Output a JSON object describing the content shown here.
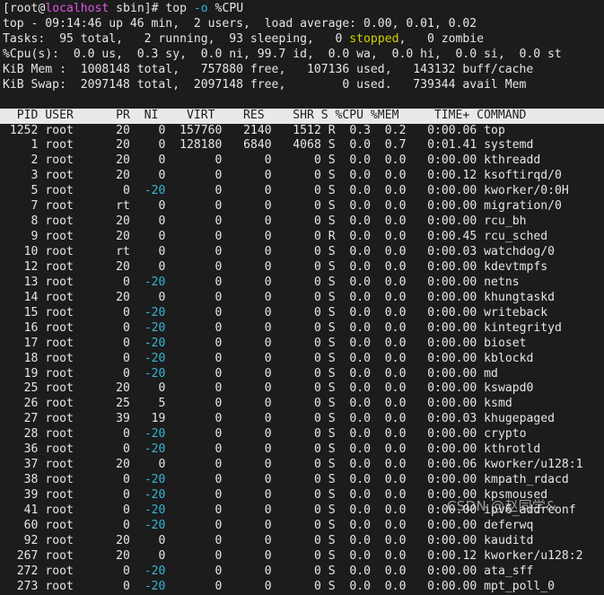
{
  "terminal": {
    "background": "#1c1c1c",
    "foreground": "#e6e6e6",
    "accent_magenta": "#e157e1",
    "accent_cyan": "#36b5d4",
    "accent_yellow": "#d2d200",
    "header_bar_bg": "#e9e9e9",
    "header_bar_fg": "#1c1c1c"
  },
  "prompt": {
    "bracket_open": "[",
    "user": "root",
    "at": "@",
    "host": "localhost",
    "space": " ",
    "dir": "sbin",
    "bracket_close": "]# ",
    "command": "top ",
    "flag": "-o",
    "flag_value": " %CPU"
  },
  "summary": {
    "line1": "top - 09:14:46 up 46 min,  2 users,  load average: 0.00, 0.01, 0.02",
    "tasks_pre": "Tasks:  95 total,   2 running,  93 sleeping,   0 ",
    "tasks_stopped": "stopped",
    "tasks_post": ",   0 zombie",
    "cpu": "%Cpu(s):  0.0 us,  0.3 sy,  0.0 ni, 99.7 id,  0.0 wa,  0.0 hi,  0.0 si,  0.0 st",
    "mem": "KiB Mem :  1008148 total,   757880 free,   107136 used,   143132 buff/cache",
    "swap": "KiB Swap:  2097148 total,  2097148 free,        0 used.   739344 avail Mem"
  },
  "table": {
    "header": "  PID USER      PR  NI    VIRT    RES    SHR S %CPU %MEM     TIME+ COMMAND",
    "columns": [
      "PID",
      "USER",
      "PR",
      "NI",
      "VIRT",
      "RES",
      "SHR",
      "S",
      "%CPU",
      "%MEM",
      "TIME+",
      "COMMAND"
    ],
    "rows": [
      {
        "pid": "1252",
        "user": "root",
        "pr": "20",
        "ni": "0",
        "ni_neg": false,
        "virt": "157760",
        "res": "2140",
        "shr": "1512",
        "s": "R",
        "cpu": "0.3",
        "mem": "0.2",
        "time": "0:00.06",
        "command": "top"
      },
      {
        "pid": "1",
        "user": "root",
        "pr": "20",
        "ni": "0",
        "ni_neg": false,
        "virt": "128180",
        "res": "6840",
        "shr": "4068",
        "s": "S",
        "cpu": "0.0",
        "mem": "0.7",
        "time": "0:01.41",
        "command": "systemd"
      },
      {
        "pid": "2",
        "user": "root",
        "pr": "20",
        "ni": "0",
        "ni_neg": false,
        "virt": "0",
        "res": "0",
        "shr": "0",
        "s": "S",
        "cpu": "0.0",
        "mem": "0.0",
        "time": "0:00.00",
        "command": "kthreadd"
      },
      {
        "pid": "3",
        "user": "root",
        "pr": "20",
        "ni": "0",
        "ni_neg": false,
        "virt": "0",
        "res": "0",
        "shr": "0",
        "s": "S",
        "cpu": "0.0",
        "mem": "0.0",
        "time": "0:00.12",
        "command": "ksoftirqd/0"
      },
      {
        "pid": "5",
        "user": "root",
        "pr": "0",
        "ni": "-20",
        "ni_neg": true,
        "virt": "0",
        "res": "0",
        "shr": "0",
        "s": "S",
        "cpu": "0.0",
        "mem": "0.0",
        "time": "0:00.00",
        "command": "kworker/0:0H"
      },
      {
        "pid": "7",
        "user": "root",
        "pr": "rt",
        "ni": "0",
        "ni_neg": false,
        "virt": "0",
        "res": "0",
        "shr": "0",
        "s": "S",
        "cpu": "0.0",
        "mem": "0.0",
        "time": "0:00.00",
        "command": "migration/0"
      },
      {
        "pid": "8",
        "user": "root",
        "pr": "20",
        "ni": "0",
        "ni_neg": false,
        "virt": "0",
        "res": "0",
        "shr": "0",
        "s": "S",
        "cpu": "0.0",
        "mem": "0.0",
        "time": "0:00.00",
        "command": "rcu_bh"
      },
      {
        "pid": "9",
        "user": "root",
        "pr": "20",
        "ni": "0",
        "ni_neg": false,
        "virt": "0",
        "res": "0",
        "shr": "0",
        "s": "R",
        "cpu": "0.0",
        "mem": "0.0",
        "time": "0:00.45",
        "command": "rcu_sched"
      },
      {
        "pid": "10",
        "user": "root",
        "pr": "rt",
        "ni": "0",
        "ni_neg": false,
        "virt": "0",
        "res": "0",
        "shr": "0",
        "s": "S",
        "cpu": "0.0",
        "mem": "0.0",
        "time": "0:00.03",
        "command": "watchdog/0"
      },
      {
        "pid": "12",
        "user": "root",
        "pr": "20",
        "ni": "0",
        "ni_neg": false,
        "virt": "0",
        "res": "0",
        "shr": "0",
        "s": "S",
        "cpu": "0.0",
        "mem": "0.0",
        "time": "0:00.00",
        "command": "kdevtmpfs"
      },
      {
        "pid": "13",
        "user": "root",
        "pr": "0",
        "ni": "-20",
        "ni_neg": true,
        "virt": "0",
        "res": "0",
        "shr": "0",
        "s": "S",
        "cpu": "0.0",
        "mem": "0.0",
        "time": "0:00.00",
        "command": "netns"
      },
      {
        "pid": "14",
        "user": "root",
        "pr": "20",
        "ni": "0",
        "ni_neg": false,
        "virt": "0",
        "res": "0",
        "shr": "0",
        "s": "S",
        "cpu": "0.0",
        "mem": "0.0",
        "time": "0:00.00",
        "command": "khungtaskd"
      },
      {
        "pid": "15",
        "user": "root",
        "pr": "0",
        "ni": "-20",
        "ni_neg": true,
        "virt": "0",
        "res": "0",
        "shr": "0",
        "s": "S",
        "cpu": "0.0",
        "mem": "0.0",
        "time": "0:00.00",
        "command": "writeback"
      },
      {
        "pid": "16",
        "user": "root",
        "pr": "0",
        "ni": "-20",
        "ni_neg": true,
        "virt": "0",
        "res": "0",
        "shr": "0",
        "s": "S",
        "cpu": "0.0",
        "mem": "0.0",
        "time": "0:00.00",
        "command": "kintegrityd"
      },
      {
        "pid": "17",
        "user": "root",
        "pr": "0",
        "ni": "-20",
        "ni_neg": true,
        "virt": "0",
        "res": "0",
        "shr": "0",
        "s": "S",
        "cpu": "0.0",
        "mem": "0.0",
        "time": "0:00.00",
        "command": "bioset"
      },
      {
        "pid": "18",
        "user": "root",
        "pr": "0",
        "ni": "-20",
        "ni_neg": true,
        "virt": "0",
        "res": "0",
        "shr": "0",
        "s": "S",
        "cpu": "0.0",
        "mem": "0.0",
        "time": "0:00.00",
        "command": "kblockd"
      },
      {
        "pid": "19",
        "user": "root",
        "pr": "0",
        "ni": "-20",
        "ni_neg": true,
        "virt": "0",
        "res": "0",
        "shr": "0",
        "s": "S",
        "cpu": "0.0",
        "mem": "0.0",
        "time": "0:00.00",
        "command": "md"
      },
      {
        "pid": "25",
        "user": "root",
        "pr": "20",
        "ni": "0",
        "ni_neg": false,
        "virt": "0",
        "res": "0",
        "shr": "0",
        "s": "S",
        "cpu": "0.0",
        "mem": "0.0",
        "time": "0:00.00",
        "command": "kswapd0"
      },
      {
        "pid": "26",
        "user": "root",
        "pr": "25",
        "ni": "5",
        "ni_neg": false,
        "virt": "0",
        "res": "0",
        "shr": "0",
        "s": "S",
        "cpu": "0.0",
        "mem": "0.0",
        "time": "0:00.00",
        "command": "ksmd"
      },
      {
        "pid": "27",
        "user": "root",
        "pr": "39",
        "ni": "19",
        "ni_neg": false,
        "virt": "0",
        "res": "0",
        "shr": "0",
        "s": "S",
        "cpu": "0.0",
        "mem": "0.0",
        "time": "0:00.03",
        "command": "khugepaged"
      },
      {
        "pid": "28",
        "user": "root",
        "pr": "0",
        "ni": "-20",
        "ni_neg": true,
        "virt": "0",
        "res": "0",
        "shr": "0",
        "s": "S",
        "cpu": "0.0",
        "mem": "0.0",
        "time": "0:00.00",
        "command": "crypto"
      },
      {
        "pid": "36",
        "user": "root",
        "pr": "0",
        "ni": "-20",
        "ni_neg": true,
        "virt": "0",
        "res": "0",
        "shr": "0",
        "s": "S",
        "cpu": "0.0",
        "mem": "0.0",
        "time": "0:00.00",
        "command": "kthrotld"
      },
      {
        "pid": "37",
        "user": "root",
        "pr": "20",
        "ni": "0",
        "ni_neg": false,
        "virt": "0",
        "res": "0",
        "shr": "0",
        "s": "S",
        "cpu": "0.0",
        "mem": "0.0",
        "time": "0:00.06",
        "command": "kworker/u128:1"
      },
      {
        "pid": "38",
        "user": "root",
        "pr": "0",
        "ni": "-20",
        "ni_neg": true,
        "virt": "0",
        "res": "0",
        "shr": "0",
        "s": "S",
        "cpu": "0.0",
        "mem": "0.0",
        "time": "0:00.00",
        "command": "kmpath_rdacd"
      },
      {
        "pid": "39",
        "user": "root",
        "pr": "0",
        "ni": "-20",
        "ni_neg": true,
        "virt": "0",
        "res": "0",
        "shr": "0",
        "s": "S",
        "cpu": "0.0",
        "mem": "0.0",
        "time": "0:00.00",
        "command": "kpsmoused"
      },
      {
        "pid": "41",
        "user": "root",
        "pr": "0",
        "ni": "-20",
        "ni_neg": true,
        "virt": "0",
        "res": "0",
        "shr": "0",
        "s": "S",
        "cpu": "0.0",
        "mem": "0.0",
        "time": "0:00.00",
        "command": "ipv6_addrconf"
      },
      {
        "pid": "60",
        "user": "root",
        "pr": "0",
        "ni": "-20",
        "ni_neg": true,
        "virt": "0",
        "res": "0",
        "shr": "0",
        "s": "S",
        "cpu": "0.0",
        "mem": "0.0",
        "time": "0:00.00",
        "command": "deferwq"
      },
      {
        "pid": "92",
        "user": "root",
        "pr": "20",
        "ni": "0",
        "ni_neg": false,
        "virt": "0",
        "res": "0",
        "shr": "0",
        "s": "S",
        "cpu": "0.0",
        "mem": "0.0",
        "time": "0:00.00",
        "command": "kauditd"
      },
      {
        "pid": "267",
        "user": "root",
        "pr": "20",
        "ni": "0",
        "ni_neg": false,
        "virt": "0",
        "res": "0",
        "shr": "0",
        "s": "S",
        "cpu": "0.0",
        "mem": "0.0",
        "time": "0:00.12",
        "command": "kworker/u128:2"
      },
      {
        "pid": "272",
        "user": "root",
        "pr": "0",
        "ni": "-20",
        "ni_neg": true,
        "virt": "0",
        "res": "0",
        "shr": "0",
        "s": "S",
        "cpu": "0.0",
        "mem": "0.0",
        "time": "0:00.00",
        "command": "ata_sff"
      },
      {
        "pid": "273",
        "user": "root",
        "pr": "0",
        "ni": "-20",
        "ni_neg": true,
        "virt": "0",
        "res": "0",
        "shr": "0",
        "s": "S",
        "cpu": "0.0",
        "mem": "0.0",
        "time": "0:00.00",
        "command": "mpt_poll_0"
      }
    ]
  },
  "watermark": {
    "text": "CSDN @赵同学&"
  }
}
